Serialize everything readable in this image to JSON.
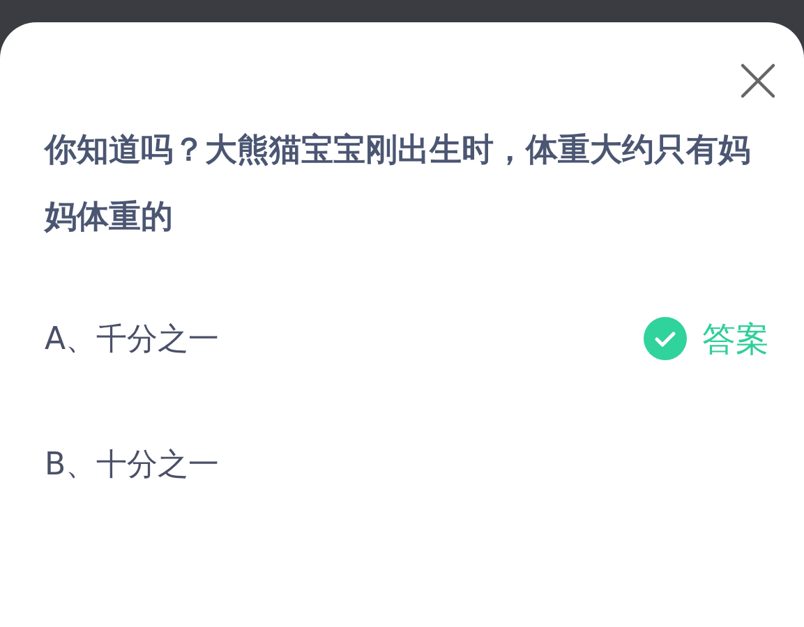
{
  "question": "你知道吗？大熊猫宝宝刚出生时，体重大约只有妈妈体重的",
  "options": [
    {
      "label": "A、千分之一",
      "answer": true
    },
    {
      "label": "B、十分之一",
      "answer": false
    }
  ],
  "answer_label": "答案"
}
